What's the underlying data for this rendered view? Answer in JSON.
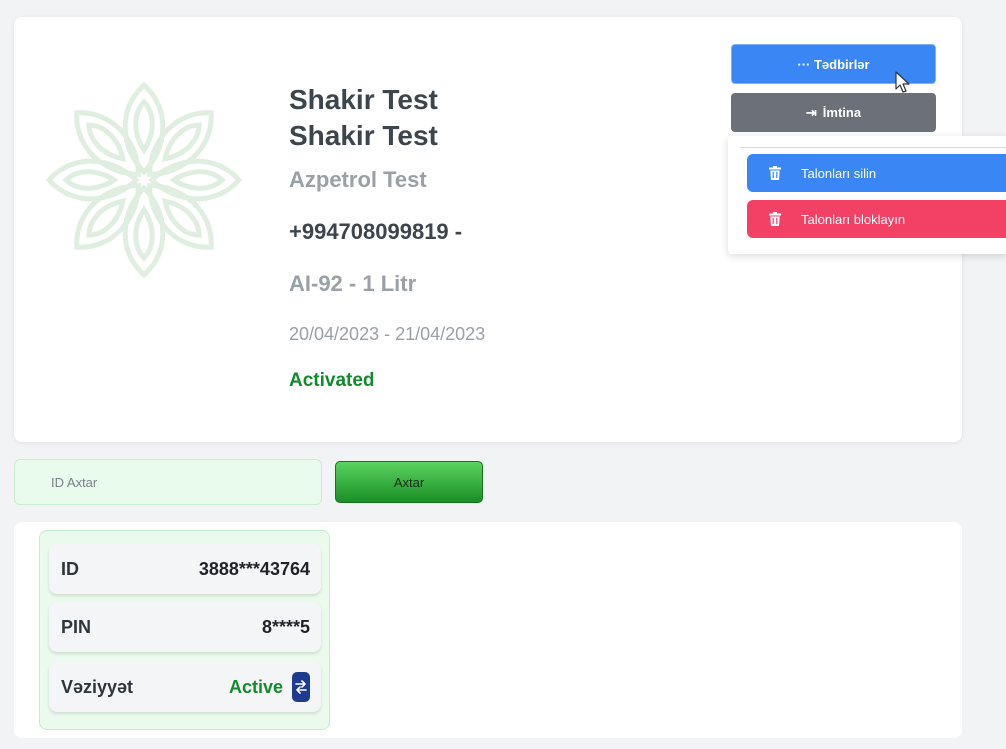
{
  "profile": {
    "name_line1": "Shakir Test",
    "name_line2": "Shakir Test",
    "company": "Azpetrol Test",
    "phone": "+994708099819 -",
    "fuel": "AI-92 - 1 Litr",
    "dates": "20/04/2023 - 21/04/2023",
    "status": "Activated"
  },
  "actions": {
    "main_label": "··· Tədbirlər",
    "cancel_icon": "⇥",
    "cancel_label": "İmtina",
    "menu": [
      {
        "label": "Talonları silin",
        "icon": "trash-icon",
        "color": "#3a86f5"
      },
      {
        "label": "Talonları bloklayın",
        "icon": "trash-icon",
        "color": "#f24164"
      }
    ]
  },
  "search": {
    "placeholder": "ID Axtar",
    "button_label": "Axtar"
  },
  "details": {
    "rows": [
      {
        "label": "ID",
        "value": "3888***43764"
      },
      {
        "label": "PIN",
        "value": "8****5"
      },
      {
        "label": "Vəziyyət",
        "value": "Active"
      }
    ]
  },
  "colors": {
    "primary": "#3a86f5",
    "danger": "#f24164",
    "success": "#138a2c",
    "secondary": "#6c7179"
  }
}
